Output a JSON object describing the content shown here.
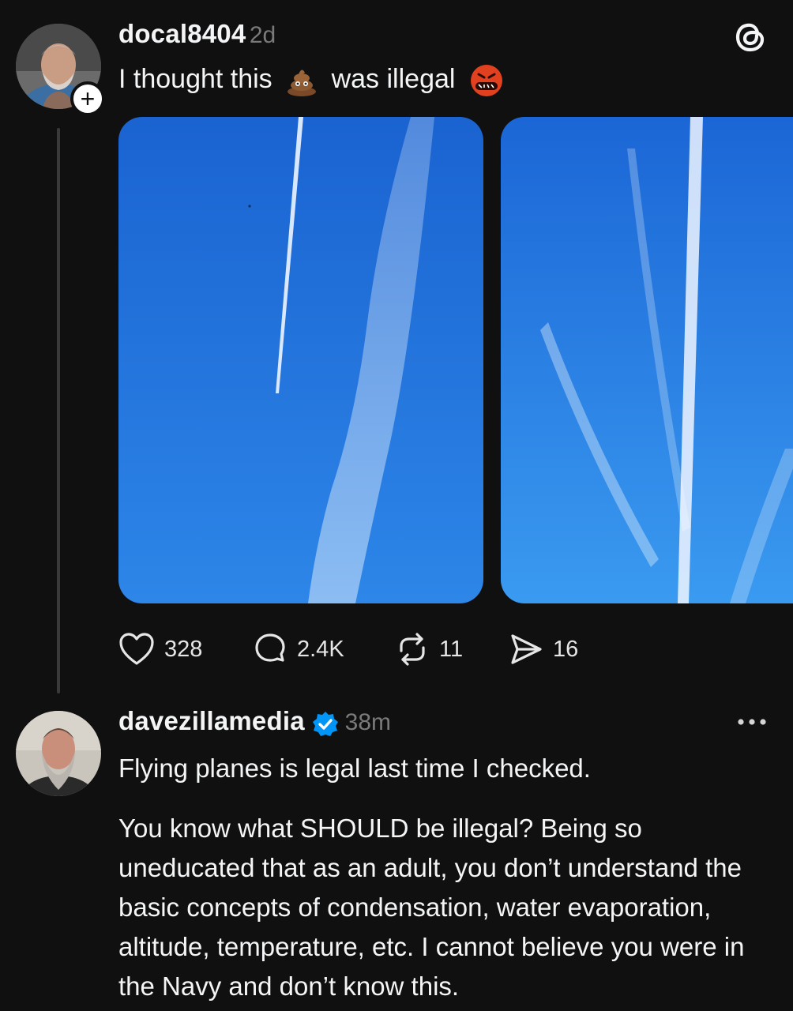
{
  "post": {
    "username": "docal8404",
    "time": "2d",
    "text_before": "I thought this",
    "text_after": "was illegal",
    "emoji_1": "pile-of-poo",
    "emoji_2": "face-with-symbols-on-mouth",
    "follow_symbol": "+",
    "app_icon": "threads-logo",
    "images": [
      {
        "icon": "sky-contrail-photo"
      },
      {
        "icon": "sky-contrail-photo"
      }
    ],
    "actions": {
      "likes": "328",
      "replies": "2.4K",
      "reposts": "11",
      "shares": "16"
    }
  },
  "reply": {
    "username": "davezillamedia",
    "time": "38m",
    "verified": true,
    "more_icon": "ellipsis-icon",
    "line_1": "Flying planes is legal last time I checked.",
    "line_2": "You know what SHOULD be illegal? Being so uneducated that as an adult, you don’t understand the basic concepts of condensation, water evaporation, altitude, temperature, etc. I cannot believe you were in the Navy and don’t know this."
  },
  "colors": {
    "background": "#101010",
    "text": "#f3f5f7",
    "secondary_text": "#7a7a7a",
    "verified_blue": "#0095f6",
    "sky": "#1f6fd8"
  }
}
